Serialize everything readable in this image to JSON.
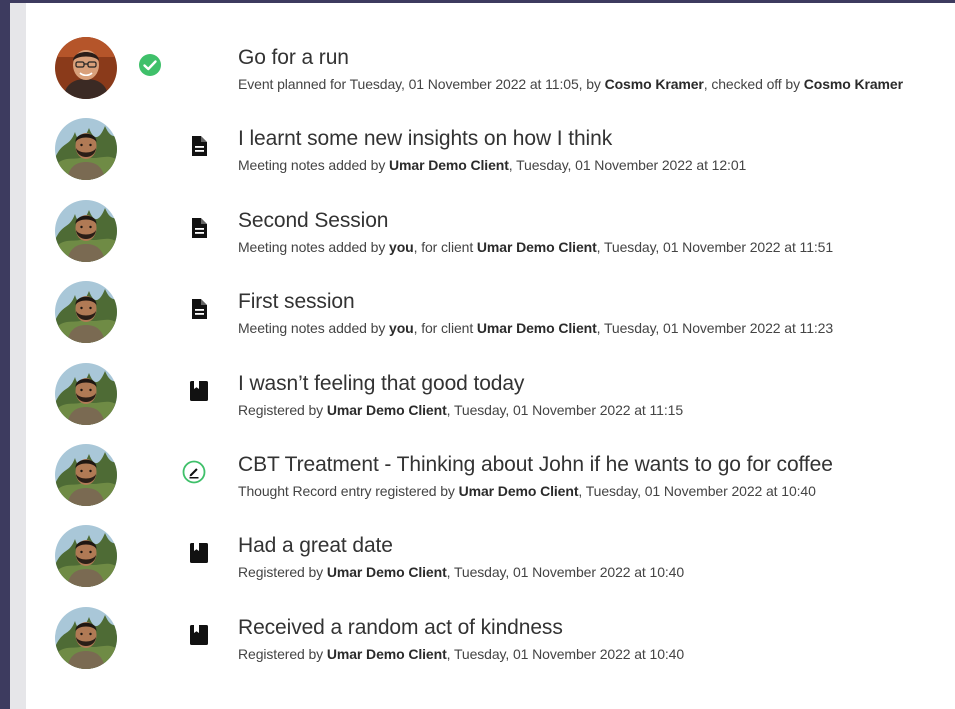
{
  "activity": {
    "items": [
      {
        "title": "Go for a run",
        "icon": "check-circle-icon",
        "avatar": "cosmo-kramer-avatar",
        "parts": [
          {
            "text": "Event planned for Tuesday, 01 November 2022 at 11:05, by ",
            "bold": false
          },
          {
            "text": "Cosmo Kramer",
            "bold": true
          },
          {
            "text": ", checked off by ",
            "bold": false
          },
          {
            "text": "Cosmo Kramer",
            "bold": true
          }
        ]
      },
      {
        "title": "I learnt some new insights on how I think",
        "icon": "document-icon",
        "avatar": "umar-demo-client-avatar",
        "parts": [
          {
            "text": "Meeting notes added by ",
            "bold": false
          },
          {
            "text": "Umar Demo Client",
            "bold": true
          },
          {
            "text": ", Tuesday, 01 November 2022 at 12:01",
            "bold": false
          }
        ]
      },
      {
        "title": "Second Session",
        "icon": "document-icon",
        "avatar": "umar-demo-client-avatar",
        "parts": [
          {
            "text": "Meeting notes added by ",
            "bold": false
          },
          {
            "text": "you",
            "bold": true
          },
          {
            "text": ", for client ",
            "bold": false
          },
          {
            "text": "Umar Demo Client",
            "bold": true
          },
          {
            "text": ", Tuesday, 01 November 2022 at 11:51",
            "bold": false
          }
        ]
      },
      {
        "title": "First session",
        "icon": "document-icon",
        "avatar": "umar-demo-client-avatar",
        "parts": [
          {
            "text": "Meeting notes added by ",
            "bold": false
          },
          {
            "text": "you",
            "bold": true
          },
          {
            "text": ", for client ",
            "bold": false
          },
          {
            "text": "Umar Demo Client",
            "bold": true
          },
          {
            "text": ", Tuesday, 01 November 2022 at 11:23",
            "bold": false
          }
        ]
      },
      {
        "title": "I wasn’t feeling that good today",
        "icon": "journal-icon",
        "avatar": "umar-demo-client-avatar",
        "parts": [
          {
            "text": "Registered by ",
            "bold": false
          },
          {
            "text": "Umar Demo Client",
            "bold": true
          },
          {
            "text": ", Tuesday, 01 November 2022 at 11:15",
            "bold": false
          }
        ]
      },
      {
        "title": "CBT Treatment - Thinking about John if he wants to go for coffee",
        "icon": "thought-record-edit-icon",
        "avatar": "umar-demo-client-avatar",
        "parts": [
          {
            "text": "Thought Record entry registered by ",
            "bold": false
          },
          {
            "text": "Umar Demo Client",
            "bold": true
          },
          {
            "text": ", Tuesday, 01 November 2022 at 10:40",
            "bold": false
          }
        ]
      },
      {
        "title": "Had a great date",
        "icon": "journal-icon",
        "avatar": "umar-demo-client-avatar",
        "parts": [
          {
            "text": "Registered by ",
            "bold": false
          },
          {
            "text": "Umar Demo Client",
            "bold": true
          },
          {
            "text": ", Tuesday, 01 November 2022 at 10:40",
            "bold": false
          }
        ]
      },
      {
        "title": "Received a random act of kindness",
        "icon": "journal-icon",
        "avatar": "umar-demo-client-avatar",
        "parts": [
          {
            "text": "Registered by ",
            "bold": false
          },
          {
            "text": "Umar Demo Client",
            "bold": true
          },
          {
            "text": ", Tuesday, 01 November 2022 at 10:40",
            "bold": false
          }
        ]
      }
    ]
  },
  "colors": {
    "page_background": "#3d3b5f",
    "panel_background": "#ffffff",
    "panel_edge": "#e6e6e9",
    "check_green": "#3fc06a",
    "title_text": "#333333",
    "subtitle_text": "#444444"
  }
}
